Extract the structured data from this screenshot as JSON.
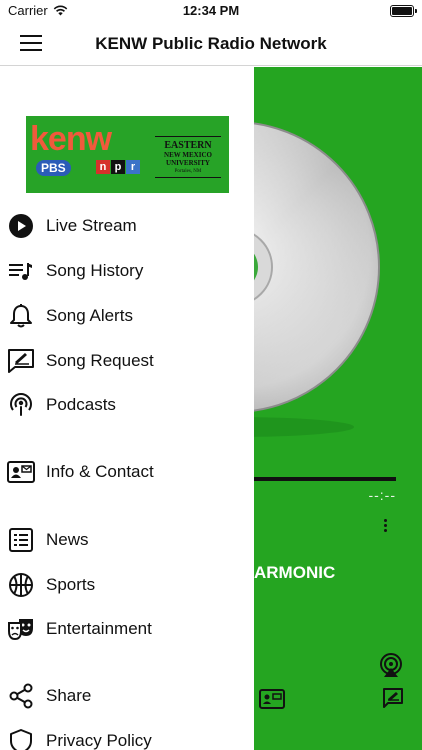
{
  "status": {
    "carrier": "Carrier",
    "time": "12:34 PM"
  },
  "nav": {
    "title": "KENW Public Radio Network"
  },
  "logo": {
    "brand": "kenw",
    "pbs": "PBS",
    "npr": [
      "n",
      "p",
      "r"
    ],
    "university_line1": "EASTERN",
    "university_line2": "NEW MEXICO",
    "university_line3": "UNIVERSITY",
    "university_city": "Portales, NM"
  },
  "menu": {
    "live_stream": "Live Stream",
    "song_history": "Song History",
    "song_alerts": "Song Alerts",
    "song_request": "Song Request",
    "podcasts": "Podcasts",
    "info_contact": "Info & Contact",
    "news": "News",
    "sports": "Sports",
    "entertainment": "Entertainment",
    "share": "Share",
    "privacy_policy": "Privacy Policy"
  },
  "player": {
    "time_remaining": "--:--",
    "station_fragment": "ARMONIC"
  },
  "colors": {
    "player_bg": "#25a521",
    "logo_bg": "#27a327",
    "kenw_orange": "#f05a3c",
    "pbs_blue": "#2b5cb8",
    "npr_red": "#d6322b",
    "npr_black": "#111111",
    "npr_blue": "#3b73c8"
  }
}
